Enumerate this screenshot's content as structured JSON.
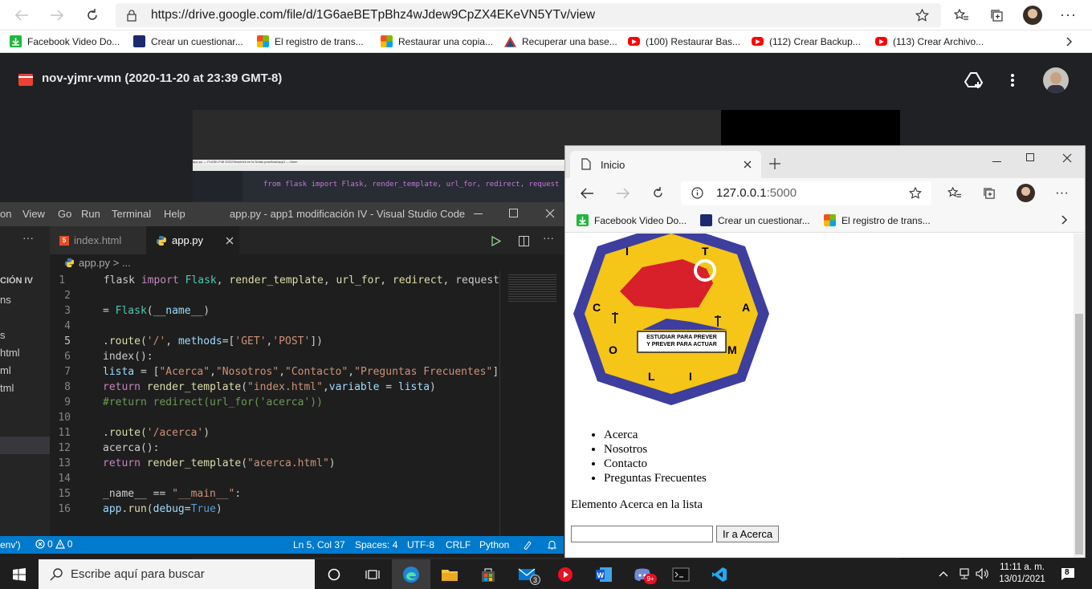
{
  "browser": {
    "url": "https://drive.google.com/file/d/1G6aeBETpBhz4wJdew9CpZX4EKeVN5YTv/view",
    "bookmarks": [
      {
        "label": "Facebook Video Do...",
        "color": "#1eb93c"
      },
      {
        "label": "Crear un cuestionar...",
        "color": "#1c2b6d"
      },
      {
        "label": "El registro de trans...",
        "color": "#f25022"
      },
      {
        "label": "Restaurar una copia...",
        "color": "#f25022"
      },
      {
        "label": "Recuperar una base...",
        "color": "#c0392b"
      },
      {
        "label": "(100) Restaurar Bas...",
        "color": "#ff0000"
      },
      {
        "label": "(112) Crear Backup...",
        "color": "#ff0000"
      },
      {
        "label": "(113) Crear Archivo...",
        "color": "#ff0000"
      }
    ]
  },
  "drive": {
    "file_title": "nov-yjmr-vmn (2020-11-20 at 23:39 GMT-8)"
  },
  "atom": {
    "title": "app.py — FLASK-F48 2021\\Sesiones en la Notas practicas\\app1 — Atom",
    "code_line": "from flask import Flask, render_template, url_for, redirect, request"
  },
  "vscode": {
    "menu": [
      "on",
      "View",
      "Go",
      "Run",
      "Terminal",
      "Help"
    ],
    "title": "app.py - app1 modificación IV - Visual Studio Code",
    "tabs": [
      {
        "label": "index.html"
      },
      {
        "label": "app.py"
      }
    ],
    "breadcrumb": "app.py > ...",
    "explorer": [
      "CIÓN IV",
      "ns",
      "s",
      "html",
      "ml",
      "tml"
    ],
    "lines": [
      {
        "n": "1",
        "t": " flask import Flask, render_template, url_for, redirect, request"
      },
      {
        "n": "2",
        "t": ""
      },
      {
        "n": "3",
        "t": "= Flask(__name__)"
      },
      {
        "n": "4",
        "t": ""
      },
      {
        "n": "5",
        "t": ".route('/', methods=['GET','POST'])"
      },
      {
        "n": "6",
        "t": "index():"
      },
      {
        "n": "7",
        "t": "lista = [\"Acerca\",\"Nosotros\",\"Contacto\",\"Preguntas Frecuentes\"]"
      },
      {
        "n": "8",
        "t": "return render_template(\"index.html\",variable = lista)"
      },
      {
        "n": "9",
        "t": "#return redirect(url_for('acerca'))"
      },
      {
        "n": "10",
        "t": ""
      },
      {
        "n": "11",
        "t": ".route('/acerca')"
      },
      {
        "n": "12",
        "t": "acerca():"
      },
      {
        "n": "13",
        "t": "return render_template(\"acerca.html\")"
      },
      {
        "n": "14",
        "t": ""
      },
      {
        "n": "15",
        "t": "_name__ == \"__main__\":"
      },
      {
        "n": "16",
        "t": "app.run(debug=True)"
      }
    ],
    "status": {
      "env": "env')",
      "errors": "0",
      "warnings": "0",
      "position": "Ln 5, Col 37",
      "spaces": "Spaces: 4",
      "encoding": "UTF-8",
      "eol": "CRLF",
      "language": "Python"
    }
  },
  "edge": {
    "tab_title": "Inicio",
    "url_host": "127.0.0.1",
    "url_port": ":5000",
    "bookmarks": [
      "Facebook Video Do...",
      "Crear un cuestionar...",
      "El registro de trans..."
    ],
    "logo": {
      "letters": [
        "I",
        "T",
        "C",
        "A",
        "O",
        "M",
        "L",
        "I"
      ],
      "banner1": "ESTUDIAR PARA PREVER",
      "banner2": "Y PREVER PARA ACTUAR"
    },
    "list": [
      "Acerca",
      "Nosotros",
      "Contacto",
      "Preguntas Frecuentes"
    ],
    "message": "Elemento Acerca en la lista",
    "button": "Ir a Acerca"
  },
  "taskbar": {
    "search_placeholder": "Escribe aquí para buscar",
    "mail_badge": "3",
    "discord_badge": "9+",
    "time": "11:11 a. m.",
    "date": "13/01/2021",
    "notifications": "8"
  }
}
